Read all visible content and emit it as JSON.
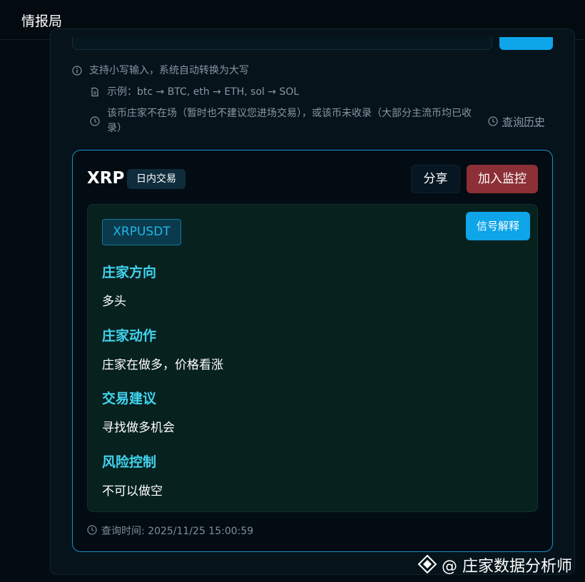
{
  "app": {
    "title": "情报局"
  },
  "hints": {
    "lowercase": "支持小写输入，系统自动转换为大写",
    "example": "示例：btc → BTC, eth → ETH, sol → SOL",
    "notice": "该币庄家不在场（暂时也不建议您进场交易），或该币未收录（大部分主流币均已收录）"
  },
  "history_link": "查询历史",
  "card": {
    "symbol": "XRP",
    "tag": "日内交易",
    "share_label": "分享",
    "monitor_label": "加入监控",
    "pair": "XRPUSDT",
    "explain_label": "信号解释",
    "sections": [
      {
        "title": "庄家方向",
        "content": "多头"
      },
      {
        "title": "庄家动作",
        "content": "庄家在做多，价格看涨"
      },
      {
        "title": "交易建议",
        "content": "寻找做多机会"
      },
      {
        "title": "风险控制",
        "content": "不可以做空"
      }
    ],
    "query_time": "查询时间: 2025/11/25 15:00:59"
  },
  "watermark": "@ 庄家数据分析师",
  "colors": {
    "accent": "#0ea5e9",
    "section_heading": "#41d4ee",
    "monitor_button": "#8c2f36",
    "card_border": "#1d8fd0"
  }
}
